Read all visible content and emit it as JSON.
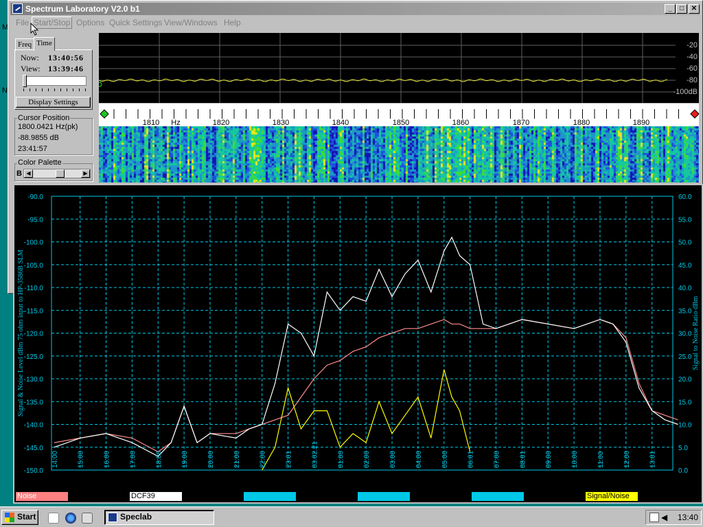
{
  "window": {
    "title": "Spectrum Laboratory V2.0 b1",
    "min": "_",
    "max": "□",
    "close": "✕"
  },
  "menu": [
    "File",
    "Start/Stop",
    "Options",
    "Quick Settings",
    "View/Windows",
    "Help"
  ],
  "left_panel": {
    "tabs": [
      "Freq",
      "Time"
    ],
    "now_label": "Now:",
    "now_value": "13:40:56",
    "view_label": "View:",
    "view_value": "13:39:46",
    "display_settings": "Display Settings",
    "cursor_title": "Cursor Position",
    "cursor_freq": "1800.0421 Hz(pk)",
    "cursor_db": "-88.9855 dB",
    "cursor_time": "23:41:57",
    "palette_title": "Color Palette",
    "palette_b": "B"
  },
  "desktop_letters": [
    "M",
    "N"
  ],
  "spectrum": {
    "db_labels": [
      "-20",
      "-40",
      "-60",
      "-80",
      "-100dB"
    ],
    "freq_labels": [
      "1810",
      "Hz",
      "1820",
      "1830",
      "1840",
      "1850",
      "1860",
      "1870",
      "1880",
      "1890"
    ]
  },
  "colors": {
    "noise": "#ff8c8c",
    "signal": "#ffffff",
    "snr": "#ffff00",
    "grid": "#00c8e6",
    "axis_text": "#00c8e6"
  },
  "chart_data": {
    "type": "line",
    "ylabel_left": "Signal & Noise Level  dBm 75 ohm input to HP-3586B SLM",
    "ylabel_right": "Signal to Noise Ratio  dBm",
    "ylim_left": [
      -150,
      -90
    ],
    "ylim_right": [
      0,
      60
    ],
    "left_ticks": [
      "-90.0",
      "-95.0",
      "-100.0",
      "-105.0",
      "-110.0",
      "-115.0",
      "-120.0",
      "-125.0",
      "-130.0",
      "-135.0",
      "-140.0",
      "-145.0",
      "-150.0"
    ],
    "right_ticks": [
      "60.0",
      "55.0",
      "50.0",
      "45.0",
      "40.0",
      "35.0",
      "30.0",
      "25.0",
      "20.0",
      "15.0",
      "10.0",
      "5.0",
      "0.0"
    ],
    "x_ticks": [
      "14:00",
      "15:00",
      "16:00",
      "17:00",
      "18:00",
      "19:00",
      "20:00",
      "21:00",
      "22:00",
      "23:01",
      "03.02.21",
      "01:00",
      "02:00",
      "03:00",
      "04:00",
      "05:00",
      "06:01",
      "07:00",
      "08:01",
      "09:00",
      "10:00",
      "11:00",
      "12:00",
      "13:01"
    ],
    "grid": true,
    "x_hours": [
      14,
      15,
      16,
      17,
      18,
      18.5,
      19,
      19.5,
      20,
      21,
      21.5,
      22,
      22.5,
      23,
      23.5,
      24,
      24.5,
      25,
      25.5,
      26,
      26.5,
      27,
      27.5,
      28,
      28.5,
      29,
      29.3,
      29.6,
      30,
      30.5,
      31,
      32,
      33,
      34,
      35,
      35.5,
      36,
      36.5,
      37,
      37.5,
      38
    ],
    "series": [
      {
        "name": "Noise",
        "values": [
          -144,
          -143,
          -142,
          -143,
          -146,
          -144,
          -136,
          -144,
          -142,
          -142,
          -141,
          -140,
          -139,
          -138,
          -134,
          -130,
          -127,
          -126,
          -124,
          -123,
          -121,
          -120,
          -119,
          -119,
          -118,
          -117,
          -118,
          -118,
          -119,
          -119,
          -119,
          -117,
          -118,
          -119,
          -117,
          -118,
          -121,
          -131,
          -137,
          -138,
          -139
        ]
      },
      {
        "name": "DCF39",
        "values": [
          -145,
          -143,
          -142,
          -144,
          -147,
          -144,
          -136,
          -144,
          -142,
          -143,
          -141,
          -140,
          -131,
          -118,
          -120,
          -125,
          -111,
          -115,
          -112,
          -113,
          -106,
          -112,
          -107,
          -104,
          -111,
          -102,
          -99,
          -103,
          -105,
          -118,
          -119,
          -117,
          -118,
          -119,
          -117,
          -118,
          -122,
          -132,
          -137,
          -139,
          -140
        ]
      },
      {
        "name": "Signal/Noise",
        "values": [
          null,
          null,
          null,
          null,
          null,
          null,
          null,
          null,
          null,
          null,
          null,
          0,
          5,
          18,
          9,
          13,
          13,
          5,
          8,
          6,
          15,
          8,
          12,
          16,
          7,
          22,
          16,
          13,
          4,
          null,
          null,
          null,
          null,
          null,
          null,
          null,
          null,
          null,
          null,
          null,
          null
        ]
      }
    ]
  },
  "legend": [
    {
      "label": "Noise",
      "bg": "#ff8080",
      "fg": "#ffffff"
    },
    {
      "label": "DCF39",
      "bg": "#ffffff",
      "fg": "#000000"
    },
    {
      "label": "",
      "bg": "#00c8e6",
      "fg": "#000000"
    },
    {
      "label": "",
      "bg": "#00c8e6",
      "fg": "#000000"
    },
    {
      "label": "",
      "bg": "#00c8e6",
      "fg": "#000000"
    },
    {
      "label": "Signal/Noise",
      "bg": "#ffff00",
      "fg": "#000000"
    }
  ],
  "taskbar": {
    "start": "Start",
    "task": "Speclab",
    "clock": "13:40"
  }
}
